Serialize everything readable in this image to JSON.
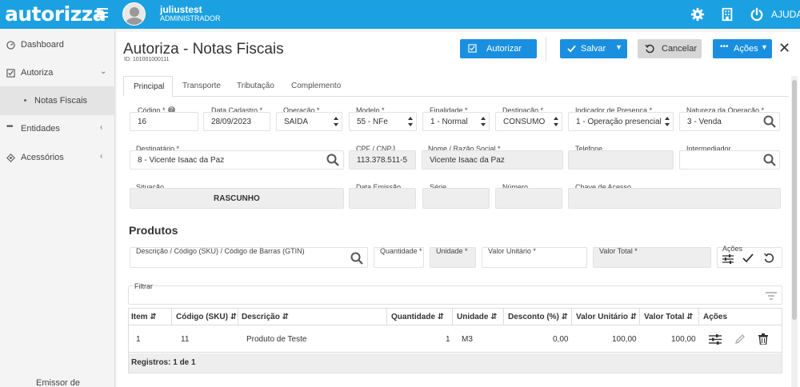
{
  "app": {
    "logo": "autorizza",
    "user_name": "juliustest",
    "user_role": "ADMINISTRADOR",
    "help_label": "AJUDA"
  },
  "sidebar": {
    "items": [
      {
        "label": "Dashboard"
      },
      {
        "label": "Autoriza"
      },
      {
        "label": "Notas Fiscais"
      },
      {
        "label": "Entidades"
      },
      {
        "label": "Acessórios"
      }
    ],
    "footer": "Emissor de"
  },
  "page": {
    "title": "Autoriza - Notas Fiscais",
    "id": "ID: 101001000111"
  },
  "toolbar": {
    "autorizar": "Autorizar",
    "salvar": "Salvar",
    "cancelar": "Cancelar",
    "acoes": "Ações"
  },
  "tabs": [
    "Principal",
    "Transporte",
    "Tributação",
    "Complemento"
  ],
  "form": {
    "codigo": {
      "label": "Código *",
      "value": "16"
    },
    "data_cadastro": {
      "label": "Data Cadastro *",
      "value": "28/09/2023"
    },
    "operacao": {
      "label": "Operação *",
      "value": "SAÍDA"
    },
    "modelo": {
      "label": "Modelo *",
      "value": "55 - NFe"
    },
    "finalidade": {
      "label": "Finalidade *",
      "value": "1 - Normal"
    },
    "destinacao": {
      "label": "Destinação *",
      "value": "CONSUMO"
    },
    "indicador": {
      "label": "Indicador de Presença *",
      "value": "1 - Operação presencial"
    },
    "natureza": {
      "label": "Natureza da Operação *",
      "value": "3 - Venda"
    },
    "destinatario": {
      "label": "Destinatário *",
      "value": "8 - Vicente Isaac da Paz"
    },
    "cpf": {
      "label": "CPF / CNPJ",
      "value": "113.378.511-5"
    },
    "nome": {
      "label": "Nome / Razão Social *",
      "value": "Vicente Isaac da Paz"
    },
    "telefone": {
      "label": "Telefone",
      "value": ""
    },
    "intermediador": {
      "label": "Intermediador",
      "value": ""
    },
    "situacao": {
      "label": "Situação",
      "value": "RASCUNHO"
    },
    "data_emissao": {
      "label": "Data Emissão",
      "value": ""
    },
    "serie": {
      "label": "Série",
      "value": ""
    },
    "numero": {
      "label": "Número",
      "value": ""
    },
    "chave": {
      "label": "Chave de Acesso",
      "value": ""
    }
  },
  "produtos": {
    "title": "Produtos",
    "descricao_label": "Descrição / Código (SKU) / Código de Barras (GTIN)",
    "quantidade_label": "Quantidade *",
    "unidade_label": "Unidade *",
    "valor_unitario_label": "Valor Unitário *",
    "valor_total_label": "Valor Total *",
    "acoes_label": "Ações",
    "filtrar_label": "Filtrar"
  },
  "table": {
    "headers": [
      "Item",
      "Código (SKU)",
      "Descrição",
      "Quantidade",
      "Unidade",
      "Desconto (%)",
      "Valor Unitário",
      "Valor Total",
      "Ações"
    ],
    "rows": [
      {
        "item": "1",
        "codigo": "11",
        "descricao": "Produto de Teste",
        "quantidade": "1",
        "unidade": "M3",
        "desconto": "0,00",
        "valor_unitario": "100,00",
        "valor_total": "100,00"
      }
    ],
    "footer": "Registros: 1 de 1"
  },
  "colors": {
    "topbar": "#1ba1e2",
    "primary_button": "#1a8fe0",
    "readonly_field": "#eeeeee"
  }
}
